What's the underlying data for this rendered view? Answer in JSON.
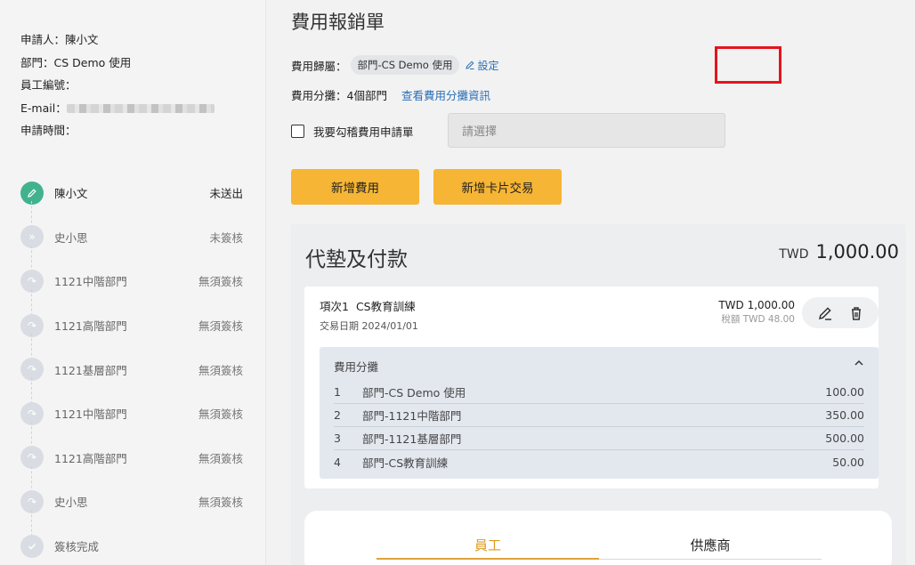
{
  "applicant": {
    "applicant_label": "申請人：",
    "applicant_value": "陳小文",
    "dept_label": "部門：",
    "dept_value": "CS Demo 使用",
    "emp_no_label": "員工編號：",
    "email_label": "E-mail：",
    "apply_time_label": "申請時間："
  },
  "workflow": {
    "steps": [
      {
        "name": "陳小文",
        "status": "未送出",
        "icon": "pencil-icon"
      },
      {
        "name": "史小思",
        "status": "未簽核",
        "icon": "double-chevron-right-icon"
      },
      {
        "name": "1121中階部門",
        "status": "無須簽核",
        "icon": "skip-arrow-icon"
      },
      {
        "name": "1121高階部門",
        "status": "無須簽核",
        "icon": "skip-arrow-icon"
      },
      {
        "name": "1121基層部門",
        "status": "無須簽核",
        "icon": "skip-arrow-icon"
      },
      {
        "name": "1121中階部門",
        "status": "無須簽核",
        "icon": "skip-arrow-icon"
      },
      {
        "name": "1121高階部門",
        "status": "無須簽核",
        "icon": "skip-arrow-icon"
      },
      {
        "name": "史小思",
        "status": "無須簽核",
        "icon": "skip-arrow-icon"
      },
      {
        "name": "簽核完成",
        "status": "",
        "icon": "check-icon"
      }
    ]
  },
  "form": {
    "title": "費用報銷單",
    "owner_label": "費用歸屬：",
    "owner_value": "部門-CS Demo 使用",
    "setting_label": "設定",
    "allocation_label": "費用分攤：4個部門",
    "allocation_link": "查看費用分攤資訊",
    "link_request_label": "我要勾稽費用申請單",
    "select_placeholder": "請選擇",
    "add_expense_button": "新增費用",
    "add_card_button": "新增卡片交易"
  },
  "advance": {
    "title": "代墊及付款",
    "total_currency": "TWD",
    "total_amount": "1,000.00",
    "item": {
      "label": "項次1",
      "name": "CS教育訓練",
      "date": "交易日期 2024/01/01",
      "amount": "TWD 1,000.00",
      "tax": "稅額 TWD 48.00"
    },
    "allocation": {
      "title": "費用分攤",
      "rows": [
        {
          "no": "1",
          "name": "部門-CS Demo 使用",
          "amount": "100.00"
        },
        {
          "no": "2",
          "name": "部門-1121中階部門",
          "amount": "350.00"
        },
        {
          "no": "3",
          "name": "部門-1121基層部門",
          "amount": "500.00"
        },
        {
          "no": "4",
          "name": "部門-CS教育訓練",
          "amount": "50.00"
        }
      ]
    }
  },
  "tabs": {
    "employee": "員工",
    "supplier": "供應商"
  },
  "colors": {
    "accent": "#f6b534",
    "active_step": "#42b28e",
    "link": "#2a6fb5",
    "highlight": "#e5141c"
  }
}
